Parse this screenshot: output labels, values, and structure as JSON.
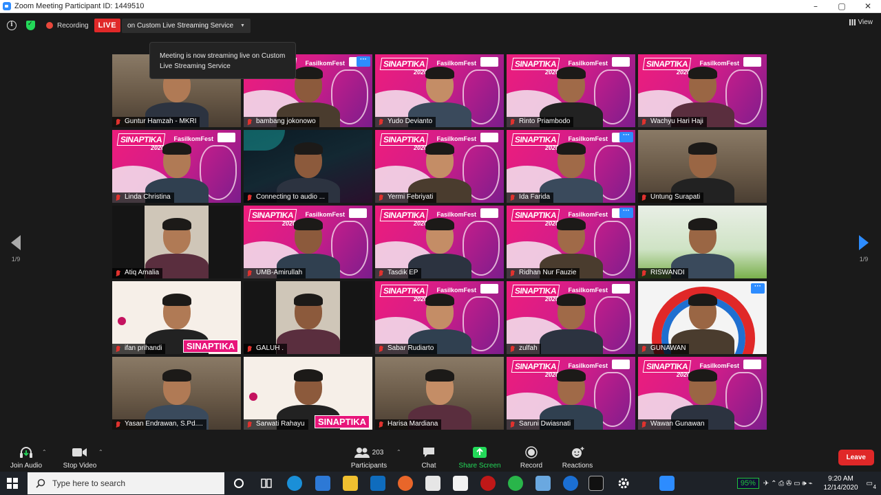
{
  "window": {
    "title": "Zoom Meeting Participant ID: 1449510",
    "controls": [
      "–",
      "▢",
      "✕"
    ]
  },
  "topbar": {
    "recording_label": "Recording",
    "live_label": "LIVE",
    "stream_service": "on Custom Live Streaming Service",
    "view_label": "View"
  },
  "tooltip": {
    "text": "Meeting is now streaming live on Custom Live Streaming Service"
  },
  "pagination": {
    "left": "1/9",
    "right": "1/9"
  },
  "tile_branding": {
    "sinaptika": "SINAPTIKA",
    "year": "2020",
    "fasilkom": "FasilkomFest"
  },
  "participants": [
    {
      "name": "Guntur Hamzah - MKRI",
      "bg": "room"
    },
    {
      "name": "bambang jokonowo",
      "bg": "slide",
      "more": true
    },
    {
      "name": "Yudo Devianto",
      "bg": "slide"
    },
    {
      "name": "Rinto Priambodo",
      "bg": "slide"
    },
    {
      "name": "Wachyu Hari Haji",
      "bg": "slide",
      "active": true
    },
    {
      "name": "Linda Christina",
      "bg": "slide"
    },
    {
      "name": "Connecting to audio ...",
      "bg": "dark"
    },
    {
      "name": "Yermi Febriyati",
      "bg": "slide"
    },
    {
      "name": "Ida Farida",
      "bg": "slide",
      "more": true
    },
    {
      "name": "Untung Surapati",
      "bg": "room"
    },
    {
      "name": "Atiq Amalia",
      "bg": "black"
    },
    {
      "name": "UMB-Amirullah",
      "bg": "slide"
    },
    {
      "name": "Tasdik EP",
      "bg": "slide"
    },
    {
      "name": "Ridhan Nur Fauzie",
      "bg": "slide",
      "more": true
    },
    {
      "name": "RISWANDI",
      "bg": "banner"
    },
    {
      "name": "ifan prihandi",
      "bg": "white",
      "sinaplogo": "SINAPTIKA"
    },
    {
      "name": "GALUH .",
      "bg": "black"
    },
    {
      "name": "Sabar Rudiarto",
      "bg": "slide"
    },
    {
      "name": "zulfah",
      "bg": "slide"
    },
    {
      "name": "GUNAWAN",
      "bg": "fas",
      "more": true
    },
    {
      "name": "Yasan Endrawan, S.Pd....",
      "bg": "room"
    },
    {
      "name": "Sarwati Rahayu",
      "bg": "white",
      "sinaplogo": "SINAPTIKA"
    },
    {
      "name": "Harisa Mardiana",
      "bg": "room"
    },
    {
      "name": "Saruni Dwiasnati",
      "bg": "slide"
    },
    {
      "name": "Wawan Gunawan",
      "bg": "slide"
    }
  ],
  "toolbar": {
    "join_audio": "Join Audio",
    "stop_video": "Stop Video",
    "participants": "Participants",
    "participant_count": "203",
    "chat": "Chat",
    "share_screen": "Share Screen",
    "record": "Record",
    "reactions": "Reactions",
    "leave": "Leave"
  },
  "taskbar": {
    "search_placeholder": "Type here to search",
    "battery": "95%",
    "time": "9:20 AM",
    "date": "12/14/2020",
    "notification_count": "4"
  },
  "colors": {
    "live_red": "#e02828",
    "zoom_blue": "#2d8cff",
    "share_green": "#23d959",
    "brand_pink": "#e8157a"
  }
}
